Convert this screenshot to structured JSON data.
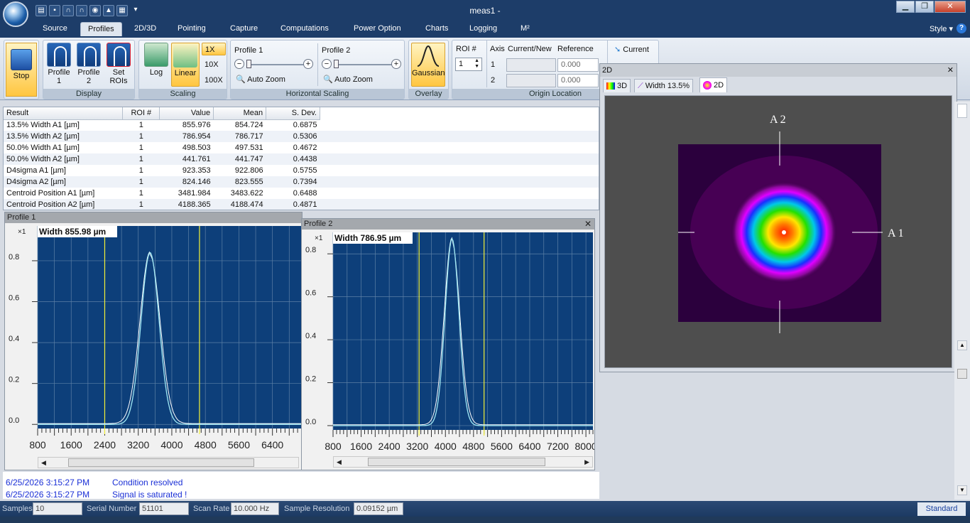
{
  "window": {
    "title": "meas1 -",
    "minimize": "▁",
    "restore": "❐",
    "close": "✕"
  },
  "ribbon_tabs": [
    "Source",
    "Profiles",
    "2D/3D",
    "Pointing",
    "Capture",
    "Computations",
    "Power Option",
    "Charts",
    "Logging",
    "M²"
  ],
  "style_menu": "Style",
  "help_label": "?",
  "ribbon": {
    "stop": "Stop",
    "display": {
      "label": "Display",
      "profile1": "Profile\n1",
      "profile2": "Profile\n2",
      "set_rois": "Set\nROIs"
    },
    "scaling": {
      "label": "Scaling",
      "log": "Log",
      "linear": "Linear",
      "x1": "1X",
      "x10": "10X",
      "x100": "100X"
    },
    "hscaling": {
      "label": "Horizontal Scaling",
      "profile1": "Profile 1",
      "profile2": "Profile 2",
      "auto_zoom": "Auto Zoom"
    },
    "overlay": {
      "label": "Overlay",
      "gaussian": "Gaussian"
    },
    "origin": {
      "label": "Origin Location",
      "roi_label": "ROI #",
      "roi_value": "1",
      "axis_label": "Axis",
      "current_new": "Current/New",
      "reference": "Reference",
      "axis1": "1",
      "axis2": "2",
      "ref1": "0.000",
      "ref2": "0.000"
    },
    "current_btn": "Current"
  },
  "results": {
    "headers": [
      "Result",
      "ROI #",
      "Value",
      "Mean",
      "S. Dev."
    ],
    "rows": [
      [
        "13.5% Width A1 [µm]",
        "1",
        "855.976",
        "854.724",
        "0.6875"
      ],
      [
        "13.5% Width A2 [µm]",
        "1",
        "786.954",
        "786.717",
        "0.5306"
      ],
      [
        "50.0% Width A1 [µm]",
        "1",
        "498.503",
        "497.531",
        "0.4672"
      ],
      [
        "50.0% Width A2 [µm]",
        "1",
        "441.761",
        "441.747",
        "0.4438"
      ],
      [
        "D4sigma A1 [µm]",
        "1",
        "923.353",
        "922.806",
        "0.5755"
      ],
      [
        "D4sigma A2 [µm]",
        "1",
        "824.146",
        "823.555",
        "0.7394"
      ],
      [
        "Centroid Position A1 [µm]",
        "1",
        "3481.984",
        "3483.622",
        "0.6488"
      ],
      [
        "Centroid Position A2 [µm]",
        "1",
        "4188.365",
        "4188.474",
        "0.4871"
      ]
    ]
  },
  "chart_data": [
    {
      "type": "line",
      "window_title": "Profile 1",
      "multiplier": "×1",
      "annotation": "Width 855.98 µm",
      "x_ticks": [
        "800",
        "1600",
        "2400",
        "3200",
        "4000",
        "4800",
        "5600",
        "6400"
      ],
      "y_ticks": [
        "0.0",
        "0.2",
        "0.4",
        "0.6",
        "0.8"
      ],
      "xlim": [
        800,
        7100
      ],
      "ylim": [
        -0.02,
        0.97
      ],
      "peak_center": 3482,
      "peak_height": 0.84,
      "width_13_5": 855.98,
      "markers": [
        2400,
        4660
      ],
      "colors": {
        "background": "#0d3f7a",
        "curve": "#9fe8f4",
        "fit": "#ffffff",
        "marker": "#f3f038",
        "grid": "#5d80a6"
      }
    },
    {
      "type": "line",
      "window_title": "Profile 2",
      "multiplier": "×1",
      "annotation": "Width 786.95 µm",
      "x_ticks": [
        "800",
        "1600",
        "2400",
        "3200",
        "4000",
        "4800",
        "5600",
        "6400",
        "7200",
        "8000"
      ],
      "y_ticks": [
        "0.0",
        "0.2",
        "0.4",
        "0.6",
        "0.8"
      ],
      "xlim": [
        800,
        8200
      ],
      "ylim": [
        -0.02,
        0.9
      ],
      "peak_center": 4188,
      "peak_height": 0.87,
      "width_13_5": 786.95,
      "markers": [
        3250,
        5100
      ],
      "colors": {
        "background": "#0d3f7a",
        "curve": "#9fe8f4",
        "fit": "#ffffff",
        "marker": "#f3f038",
        "grid": "#5d80a6"
      }
    }
  ],
  "view2d": {
    "window_title": "2D",
    "close": "✕",
    "tabs": [
      "3D",
      "Width 13.5%",
      "2D"
    ],
    "axis_a1": "A 1",
    "axis_a2": "A 2"
  },
  "log": [
    {
      "time": "6/25/2026 3:15:27 PM",
      "message": "Condition resolved"
    },
    {
      "time": "6/25/2026 3:15:27 PM",
      "message": "Signal is saturated !"
    }
  ],
  "status": {
    "samples_label": "Samples",
    "samples": "10",
    "serial_label": "Serial Number",
    "serial": "51101",
    "rate_label": "Scan Rate",
    "rate": "10.000 Hz",
    "res_label": "Sample Resolution",
    "res": "0.09152 µm",
    "mode": "Standard"
  }
}
